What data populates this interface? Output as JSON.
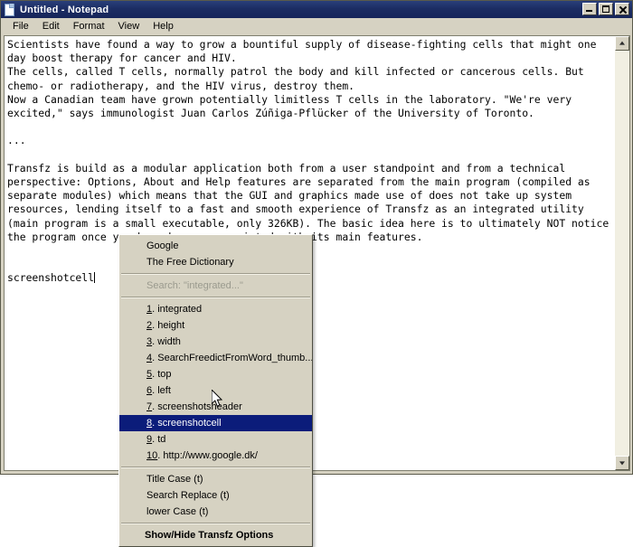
{
  "window": {
    "title": "Untitled - Notepad",
    "icon": "notepad-document-icon",
    "title_bar_color": "#1c2d63",
    "controls": [
      {
        "name": "minimize-button",
        "label": "Minimize"
      },
      {
        "name": "maximize-button",
        "label": "Maximize"
      },
      {
        "name": "close-button",
        "label": "Close"
      }
    ]
  },
  "menubar": {
    "items": [
      {
        "label": "File"
      },
      {
        "label": "Edit"
      },
      {
        "label": "Format"
      },
      {
        "label": "View"
      },
      {
        "label": "Help"
      }
    ]
  },
  "editor": {
    "body_before_caret": "Scientists have found a way to grow a bountiful supply of disease-fighting cells that might one day boost therapy for cancer and HIV.\nThe cells, called T cells, normally patrol the body and kill infected or cancerous cells. But chemo- or radiotherapy, and the HIV virus, destroy them.\nNow a Canadian team have grown potentially limitless T cells in the laboratory. \"We're very excited,\" says immunologist Juan Carlos Zúñiga-Pflücker of the University of Toronto.\n\n...\n\nTransfz is build as a modular application both from a user standpoint and from a technical perspective: Options, About and Help features are separated from the main program (compiled as separate modules) which means that the GUI and graphics made use of does not take up system resources, lending itself to a fast and smooth experience of Transfz as an integrated utility (main program is a small executable, only 326KB). The basic idea here is to ultimately NOT notice the program once you have become acquainted with its main features.\n\n\nscreenshotcell",
    "caret_visible": true
  },
  "scrollbar": {
    "up_arrow": "scroll-up-arrow-icon",
    "down_arrow": "scroll-down-arrow-icon"
  },
  "context_menu": {
    "groups": [
      {
        "items": [
          {
            "name": "menu-item-google",
            "label": "Google",
            "state": "normal"
          },
          {
            "name": "menu-item-free-dictionary",
            "label": "The Free Dictionary",
            "state": "normal"
          }
        ]
      },
      {
        "items": [
          {
            "name": "menu-item-search-query",
            "label": "Search: \"integrated...\"",
            "state": "disabled"
          }
        ]
      },
      {
        "items": [
          {
            "name": "menu-item-1-integrated",
            "accel": "1",
            "label": ". integrated",
            "state": "normal"
          },
          {
            "name": "menu-item-2-height",
            "accel": "2",
            "label": ". height",
            "state": "normal"
          },
          {
            "name": "menu-item-3-width",
            "accel": "3",
            "label": ". width",
            "state": "normal"
          },
          {
            "name": "menu-item-4-searchfreedictfromword",
            "accel": "4",
            "label": ". SearchFreedictFromWord_thumb....",
            "state": "normal"
          },
          {
            "name": "menu-item-5-top",
            "accel": "5",
            "label": ". top",
            "state": "normal"
          },
          {
            "name": "menu-item-6-left",
            "accel": "6",
            "label": ". left",
            "state": "normal"
          },
          {
            "name": "menu-item-7-screenshotsheader",
            "accel": "7",
            "label": ". screenshotsheader",
            "state": "normal"
          },
          {
            "name": "menu-item-8-screenshotcell",
            "accel": "8",
            "label": ". screenshotcell",
            "state": "selected"
          },
          {
            "name": "menu-item-9-td",
            "accel": "9",
            "label": ". td",
            "state": "normal"
          },
          {
            "name": "menu-item-10-google-url",
            "accel": "10",
            "label": ". http://www.google.dk/",
            "state": "normal"
          }
        ]
      },
      {
        "items": [
          {
            "name": "menu-item-title-case",
            "label": "Title Case (t)",
            "state": "normal"
          },
          {
            "name": "menu-item-search-replace",
            "label": "Search Replace (t)",
            "state": "normal"
          },
          {
            "name": "menu-item-lower-case",
            "label": "lower Case (t)",
            "state": "normal"
          }
        ]
      },
      {
        "items": [
          {
            "name": "menu-item-show-hide-transfz-options",
            "label": "Show/Hide Transfz Options",
            "state": "bold"
          }
        ]
      }
    ],
    "highlight_color": "#0b1c7a"
  },
  "cursor": {
    "name": "mouse-pointer-icon"
  }
}
